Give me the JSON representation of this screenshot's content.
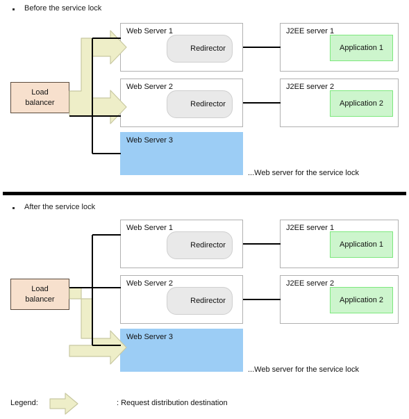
{
  "diagram": {
    "colors": {
      "arrow_fill": "#eeeec8",
      "arrow_stroke": "#c8c8a0",
      "locked_server": "#9ccdf5",
      "load_balancer": "#f7e0cd",
      "application": "#cdf5cd",
      "application_border": "#7de87d",
      "redirector": "#e9e9e9",
      "line": "#000000",
      "box_border": "#b0b0b0"
    },
    "sections": [
      {
        "id": "before",
        "heading": "Before the service lock",
        "web_servers": [
          {
            "title": "Web Server 1",
            "inner": "Redirector",
            "locked": false
          },
          {
            "title": "Web Server 2",
            "inner": "Redirector",
            "locked": false
          },
          {
            "title": "Web Server 3",
            "inner": null,
            "locked": true
          }
        ],
        "j2ee_servers": [
          {
            "title": "J2EE server 1",
            "app": "Application 1"
          },
          {
            "title": "J2EE server 2",
            "app": "Application 2"
          }
        ],
        "load_balancer": {
          "line1": "Load",
          "line2": "balancer"
        },
        "caption": "...Web server for the service lock"
      },
      {
        "id": "after",
        "heading": "After the service lock",
        "web_servers": [
          {
            "title": "Web Server 1",
            "inner": "Redirector",
            "locked": false
          },
          {
            "title": "Web Server 2",
            "inner": "Redirector",
            "locked": false
          },
          {
            "title": "Web Server 3",
            "inner": null,
            "locked": true
          }
        ],
        "j2ee_servers": [
          {
            "title": "J2EE server 1",
            "app": "Application 1"
          },
          {
            "title": "J2EE server 2",
            "app": "Application 2"
          }
        ],
        "load_balancer": {
          "line1": "Load",
          "line2": "balancer"
        },
        "caption": "...Web server for the service lock"
      }
    ],
    "legend": {
      "label": "Legend:",
      "description": ": Request distribution destination"
    }
  }
}
